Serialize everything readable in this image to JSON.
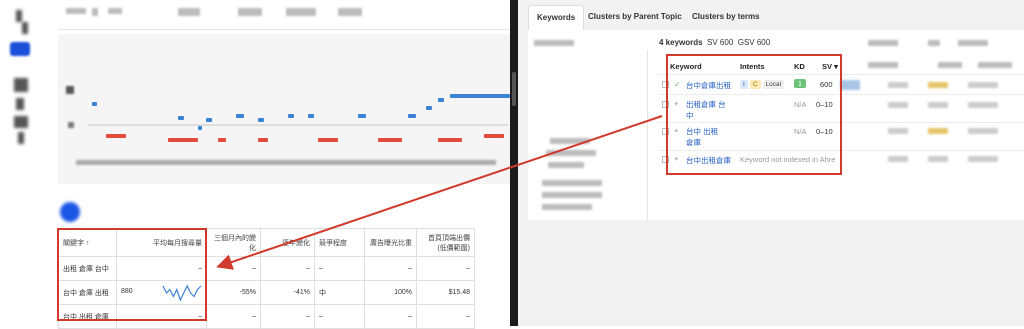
{
  "left_table": {
    "headers": [
      "關鍵字 ↑",
      "平均每月搜尋量",
      "三個月內的變化",
      "逐年變化",
      "競爭程度",
      "廣告曝光比重",
      "首頁頂端出價\n(低價範圍)"
    ],
    "rows": [
      {
        "keyword": "出租 倉庫 台中",
        "volume": "–",
        "change3m": "–",
        "yoy": "–",
        "competition": "–",
        "impression": "–",
        "bid": "–"
      },
      {
        "keyword": "台中 倉庫 出租",
        "volume": "880",
        "change3m": "-55%",
        "yoy": "-41%",
        "competition": "中",
        "impression": "100%",
        "bid": "$15.48"
      },
      {
        "keyword": "台中 出租 倉庫",
        "volume": "–",
        "change3m": "–",
        "yoy": "–",
        "competition": "–",
        "impression": "–",
        "bid": "–"
      }
    ],
    "sparkline": [
      6,
      4,
      5,
      3,
      5,
      2,
      4,
      6,
      4,
      3,
      5,
      6
    ]
  },
  "right": {
    "tabs": [
      "Keywords",
      "Clusters by Parent Topic",
      "Clusters by terms"
    ],
    "summary": {
      "count": "4 keywords",
      "sv": "SV 600",
      "gsv": "GSV 600"
    },
    "columns": {
      "keyword": "Keyword",
      "intents": "Intents",
      "kd": "KD",
      "sv": "SV ▾"
    },
    "rows": [
      {
        "icon": "✓",
        "keyword": "台中倉庫出租",
        "intent_i": "I",
        "intent_c": "C",
        "intent_local": "Local",
        "kd": "1",
        "sv": "600"
      },
      {
        "icon": "+",
        "keyword": "出租倉庫 台中",
        "kd": "N/A",
        "sv": "0–10"
      },
      {
        "icon": "+",
        "keyword": "台中 出租 倉庫",
        "kd": "N/A",
        "sv": "0–10"
      },
      {
        "icon": "+",
        "keyword": "台中出租倉庫",
        "note": "Keyword not indexed in Ahre"
      }
    ]
  },
  "colors": {
    "arrow": "#d0392b",
    "accent": "#2660c4",
    "kd_green": "#6cc47a"
  }
}
